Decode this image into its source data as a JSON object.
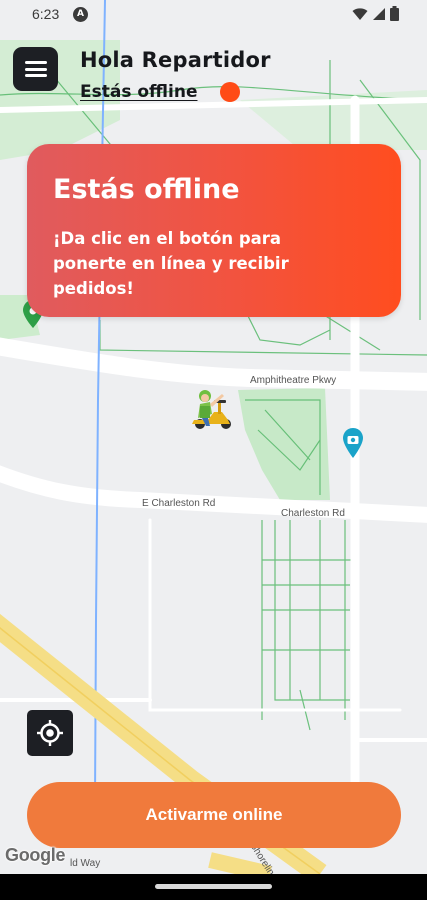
{
  "status_bar": {
    "time": "6:23",
    "notification_icon": "a-badge-icon",
    "system_icons": [
      "wifi-icon",
      "signal-icon",
      "battery-icon"
    ]
  },
  "header": {
    "greeting": "Hola Repartidor",
    "status_text": "Estás offline",
    "status_color": "#ff4b16"
  },
  "offline_card": {
    "title": "Estás offline",
    "message": "¡Da clic en el botón para ponerte en línea y recibir pedidos!"
  },
  "map": {
    "road_labels": {
      "amphitheatre": "Amphitheatre Pkwy",
      "charleston_west": "E Charleston Rd",
      "charleston_east": "Charleston Rd",
      "shoreline": "Shoreline Blvd",
      "wy": "ld Way"
    },
    "attribution": "Google"
  },
  "actions": {
    "online_button": "Activarme online"
  },
  "colors": {
    "card_gradient_start": "#e05b5e",
    "card_gradient_end": "#ff4d1f",
    "button": "#f07a3c",
    "dark_controls": "#1d1f24"
  }
}
